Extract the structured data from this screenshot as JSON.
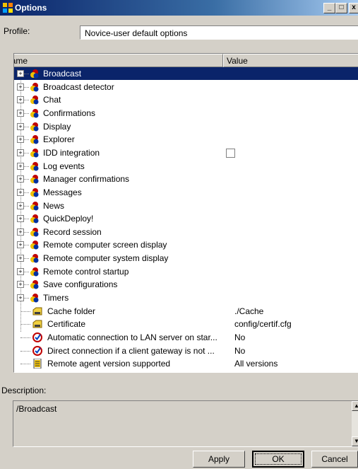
{
  "window": {
    "title": "Options",
    "minimize_label": "_",
    "maximize_label": "□",
    "close_label": "x"
  },
  "profile": {
    "label": "Profile:",
    "value": "Novice-user default options"
  },
  "list": {
    "col_name": "Name",
    "col_value": "Value",
    "rows": [
      {
        "name": "Broadcast",
        "type": "folder",
        "selected": true
      },
      {
        "name": "Broadcast detector",
        "type": "folder"
      },
      {
        "name": "Chat",
        "type": "folder"
      },
      {
        "name": "Confirmations",
        "type": "folder"
      },
      {
        "name": "Display",
        "type": "folder"
      },
      {
        "name": "Explorer",
        "type": "folder"
      },
      {
        "name": "IDD integration",
        "type": "folder",
        "checkbox": true
      },
      {
        "name": "Log events",
        "type": "folder"
      },
      {
        "name": "Manager confirmations",
        "type": "folder"
      },
      {
        "name": "Messages",
        "type": "folder"
      },
      {
        "name": "News",
        "type": "folder"
      },
      {
        "name": "QuickDeploy!",
        "type": "folder"
      },
      {
        "name": "Record session",
        "type": "folder"
      },
      {
        "name": "Remote computer screen display",
        "type": "folder"
      },
      {
        "name": "Remote computer system display",
        "type": "folder"
      },
      {
        "name": "Remote control startup",
        "type": "folder"
      },
      {
        "name": "Save configurations",
        "type": "folder"
      },
      {
        "name": "Timers",
        "type": "folder"
      },
      {
        "name": "Cache folder",
        "type": "path",
        "value": "./Cache"
      },
      {
        "name": "Certificate",
        "type": "path",
        "value": "config/certif.cfg"
      },
      {
        "name": "Automatic connection to LAN server on star...",
        "type": "bool",
        "value": "No"
      },
      {
        "name": "Direct connection if a client gateway is not ...",
        "type": "bool",
        "value": "No"
      },
      {
        "name": "Remote agent version supported",
        "type": "list",
        "value": "All versions"
      }
    ]
  },
  "description": {
    "label": "Description:",
    "text": "/Broadcast"
  },
  "buttons": {
    "apply": "Apply",
    "ok": "OK",
    "cancel": "Cancel"
  },
  "colors": {
    "selection": "#0a246a",
    "face": "#d4d0c8"
  }
}
